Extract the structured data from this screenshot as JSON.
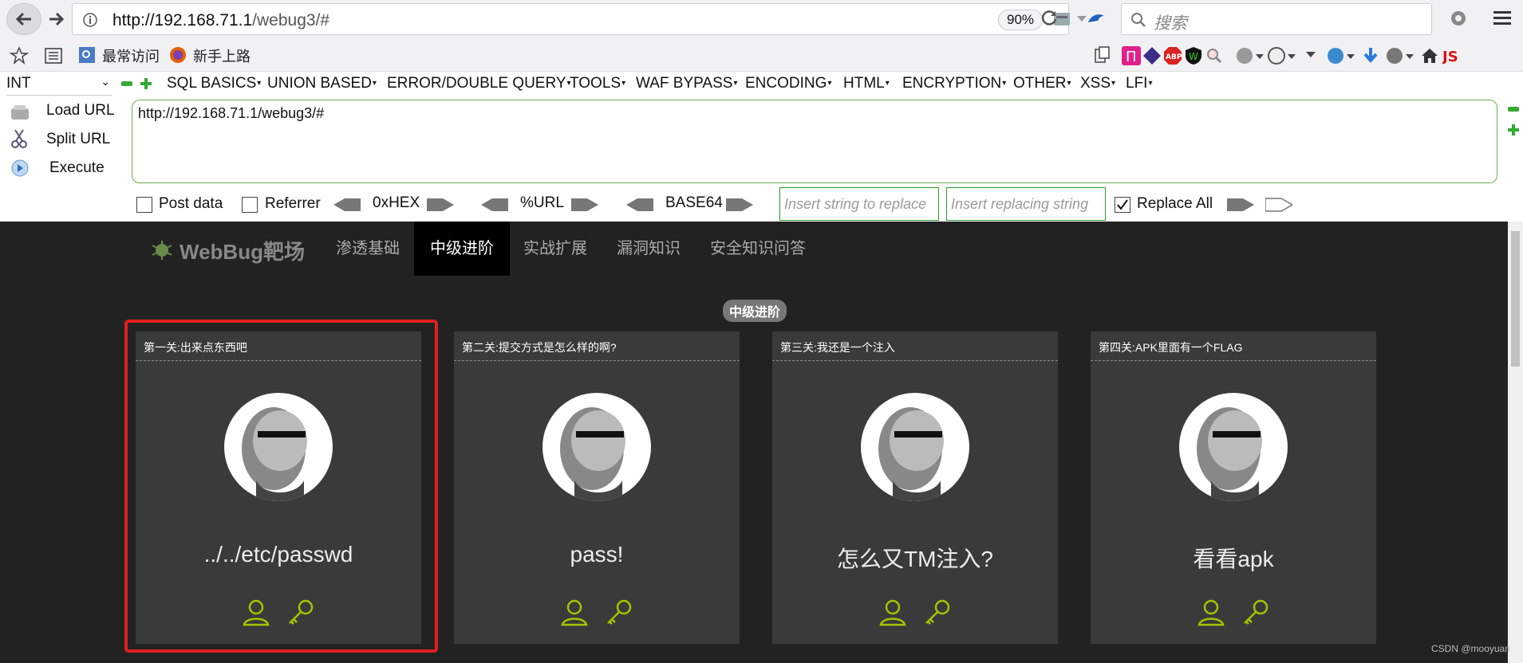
{
  "browser": {
    "url_host": "http://192.168.71.1",
    "url_path": "/webug3/#",
    "zoom": "90%",
    "search_placeholder": "搜索"
  },
  "bookmarks": {
    "item1": "最常访问",
    "item2": "新手上路"
  },
  "hackbar": {
    "int_select": "INT",
    "menus": [
      "SQL BASICS",
      "UNION BASED",
      "ERROR/DOUBLE QUERY",
      "TOOLS",
      "WAF BYPASS",
      "ENCODING",
      "HTML",
      "ENCRYPTION",
      "OTHER",
      "XSS",
      "LFI"
    ],
    "load_url": "Load URL",
    "split_url": "Split URL",
    "execute": "Execute",
    "url_value": "http://192.168.71.1/webug3/#",
    "post_data": "Post data",
    "referrer": "Referrer",
    "hex": "0xHEX",
    "url_enc": "%URL",
    "base64": "BASE64",
    "replace_ph": "Insert string to replace",
    "replacing_ph": "Insert replacing string",
    "replace_all": "Replace All"
  },
  "site": {
    "logo": "WebBug靶场",
    "nav": [
      "渗透基础",
      "中级进阶",
      "实战扩展",
      "漏洞知识",
      "安全知识问答"
    ],
    "active_nav": "中级进阶",
    "badge": "中级进阶",
    "cards": [
      {
        "title": "第一关:出来点东西吧",
        "text": "../../etc/passwd"
      },
      {
        "title": "第二关:提交方式是怎么样的啊?",
        "text": "pass!"
      },
      {
        "title": "第三关:我还是一个注入",
        "text": "怎么又TM注入?"
      },
      {
        "title": "第四关:APK里面有一个FLAG",
        "text": "看看apk"
      }
    ]
  },
  "watermark": "CSDN @mooyuan",
  "colors": {
    "accent_green": "#a4c400",
    "highlight_red": "#e02020",
    "hackbar_border": "#6ab04c"
  }
}
